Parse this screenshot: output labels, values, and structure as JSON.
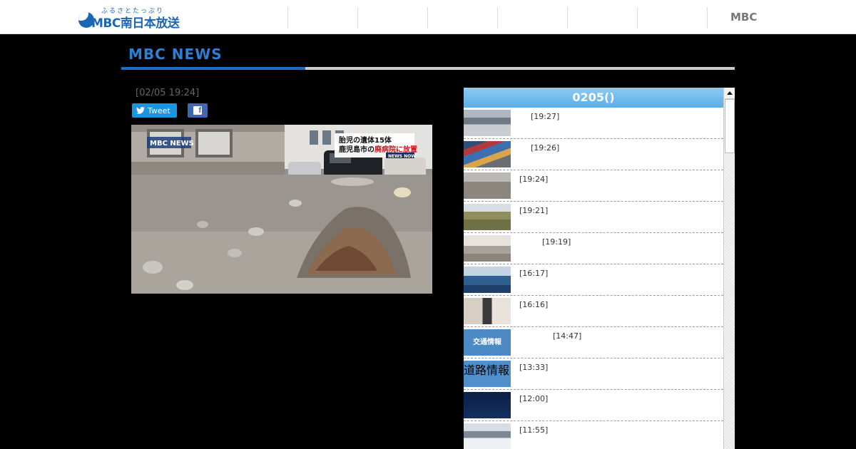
{
  "header": {
    "logo_tagline": "ふるさとたっぷり",
    "logo_text": "MBC南日本放送",
    "nav_right": "MBC"
  },
  "section": {
    "title": "MBC NEWS"
  },
  "article": {
    "date": "[02/05 19:24]",
    "tweet_label": "Tweet",
    "photo": {
      "watermark": "MBC NEWS",
      "caption_line1": "胎児の遺体15体",
      "caption_line2_prefix": "鹿児島市の",
      "caption_line2_highlight": "廃病院に放置",
      "caption_tag": "NEWS NOW"
    }
  },
  "side_panel": {
    "header": "0205()",
    "items": [
      {
        "time": "[19:27]",
        "thumb": "street"
      },
      {
        "time": "[19:26]",
        "thumb": "run"
      },
      {
        "time": "[19:24]",
        "thumb": "ground"
      },
      {
        "time": "[19:21]",
        "thumb": "field"
      },
      {
        "time": "[19:19]",
        "thumb": "road"
      },
      {
        "time": "[16:17]",
        "thumb": "sea"
      },
      {
        "time": "[16:16]",
        "thumb": "press"
      },
      {
        "time": "[14:47]",
        "thumb": "traffic",
        "thumb_label": "交通情報"
      },
      {
        "time": "[13:33]",
        "thumb": "car",
        "thumb_label": "道路情報"
      },
      {
        "time": "[12:00]",
        "thumb": "map"
      },
      {
        "time": "[11:55]",
        "thumb": "snow"
      }
    ]
  },
  "colors": {
    "brand": "#1b65b5",
    "accent": "#2d7fd1",
    "tweet": "#1b95e0",
    "facebook": "#4267b2"
  }
}
